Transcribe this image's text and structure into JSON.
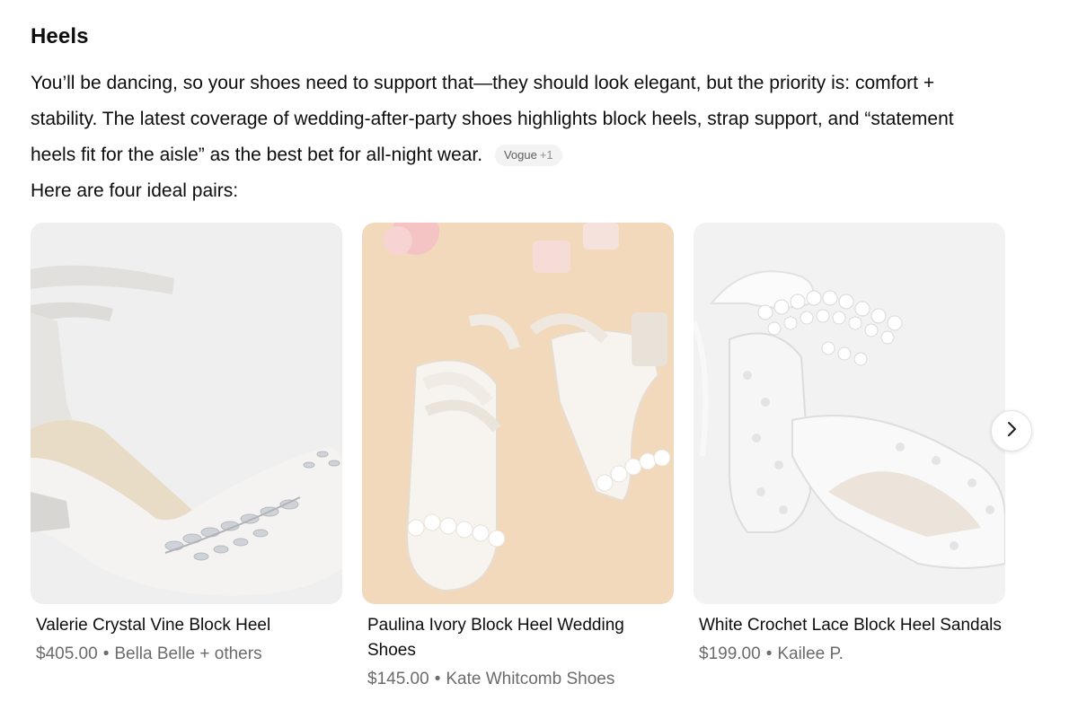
{
  "section": {
    "heading": "Heels",
    "paragraph": "You’ll be dancing, so your shoes need to support that—they should look elegant, but the priority is: comfort + stability. The latest coverage of wedding-after-party shoes highlights block heels, strap support, and “statement heels fit for the aisle” as the best bet for all-night wear.",
    "citation": {
      "source": "Vogue",
      "extra": "+1"
    },
    "intro": "Here are four ideal pairs:"
  },
  "products": [
    {
      "title": "Valerie Crystal Vine Block Heel",
      "price": "$405.00",
      "seller": "Bella Belle + others",
      "image_icon": "satin-heel-with-crystal-vine-image"
    },
    {
      "title": "Paulina Ivory Block Heel Wedding Shoes",
      "price": "$145.00",
      "seller": "Kate Whitcomb Shoes",
      "image_icon": "ivory-strappy-sandals-image"
    },
    {
      "title": "White Crochet Lace Block Heel Sandals",
      "price": "$199.00",
      "seller": "Kailee P.",
      "image_icon": "lace-pearl-block-heel-image"
    }
  ],
  "carousel": {
    "next_icon": "chevron-right-icon"
  },
  "colors": {
    "text": "#0d0d0d",
    "muted": "#6b6b6b",
    "pill_bg": "#f3f3f3",
    "card_bg_1": "#efefef",
    "card_bg_2": "#f3d9bb",
    "card_bg_3": "#f2f2f2"
  }
}
